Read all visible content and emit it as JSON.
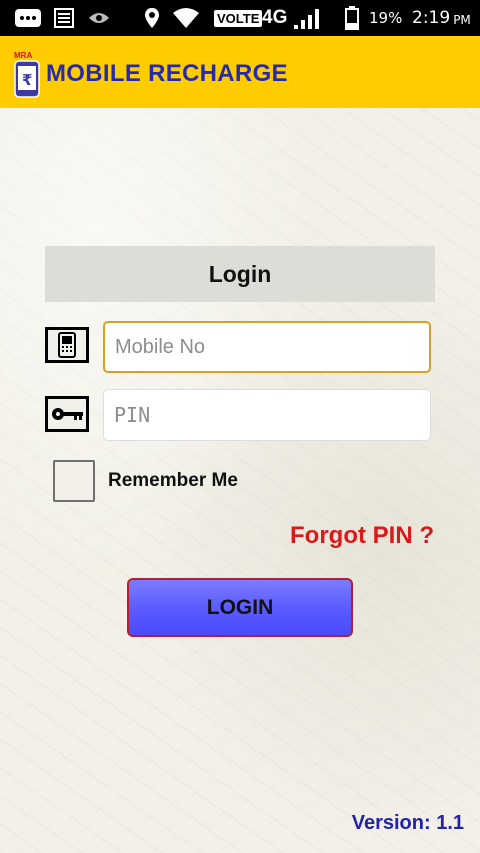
{
  "status_bar": {
    "network_label": "VOLTE",
    "network_type": "4G",
    "battery_percent": "19%",
    "time": "2:19",
    "time_suffix": "PM",
    "icons": [
      "message-icon",
      "notes-icon",
      "eye-icon",
      "location-icon",
      "wifi-icon",
      "signal-icon",
      "battery-icon"
    ]
  },
  "header": {
    "logo_text": "MRA",
    "title": "MOBILE RECHARGE",
    "background_color": "#ffcc00",
    "title_color": "#2a2aa8"
  },
  "login_form": {
    "title": "Login",
    "mobile_placeholder": "Mobile No",
    "mobile_value": "",
    "pin_placeholder": "PIN",
    "pin_value": "",
    "remember_label": "Remember Me",
    "remember_checked": false,
    "forgot_link": "Forgot PIN ?",
    "login_button": "LOGIN",
    "mobile_icon": "mobile-phone-icon",
    "pin_icon": "key-icon"
  },
  "footer": {
    "version": "Version: 1.1"
  },
  "colors": {
    "forgot_link": "#d81a1a",
    "login_button": "#5c5cff",
    "version": "#2222aa"
  }
}
